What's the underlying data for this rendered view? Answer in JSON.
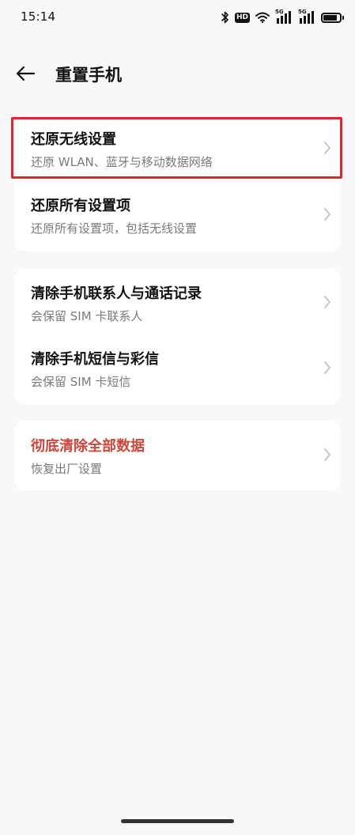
{
  "status_bar": {
    "time": "15:14",
    "hd_badge": "HD",
    "sim1_label": "5G",
    "sim2_label": "5G",
    "battery_level": 0.85,
    "icons": [
      "bluetooth-icon",
      "hd-icon",
      "wifi-icon",
      "signal-icon",
      "signal-icon",
      "battery-icon"
    ]
  },
  "header": {
    "back_icon": "arrow-left-icon",
    "title": "重置手机"
  },
  "groups": [
    {
      "items": [
        {
          "title": "还原无线设置",
          "subtitle": "还原 WLAN、蓝牙与移动数据网络",
          "highlighted": true
        },
        {
          "title": "还原所有设置项",
          "subtitle": "还原所有设置项，包括无线设置"
        }
      ]
    },
    {
      "items": [
        {
          "title": "清除手机联系人与通话记录",
          "subtitle": "会保留 SIM 卡联系人"
        },
        {
          "title": "清除手机短信与彩信",
          "subtitle": "会保留 SIM 卡短信"
        }
      ]
    },
    {
      "items": [
        {
          "title": "彻底清除全部数据",
          "subtitle": "恢复出厂设置",
          "danger": true
        }
      ]
    }
  ],
  "colors": {
    "background": "#f7f8fa",
    "card": "#ffffff",
    "danger_text": "#d0453a",
    "highlight_border": "#e0262c",
    "secondary_text": "#7a7a7a"
  }
}
